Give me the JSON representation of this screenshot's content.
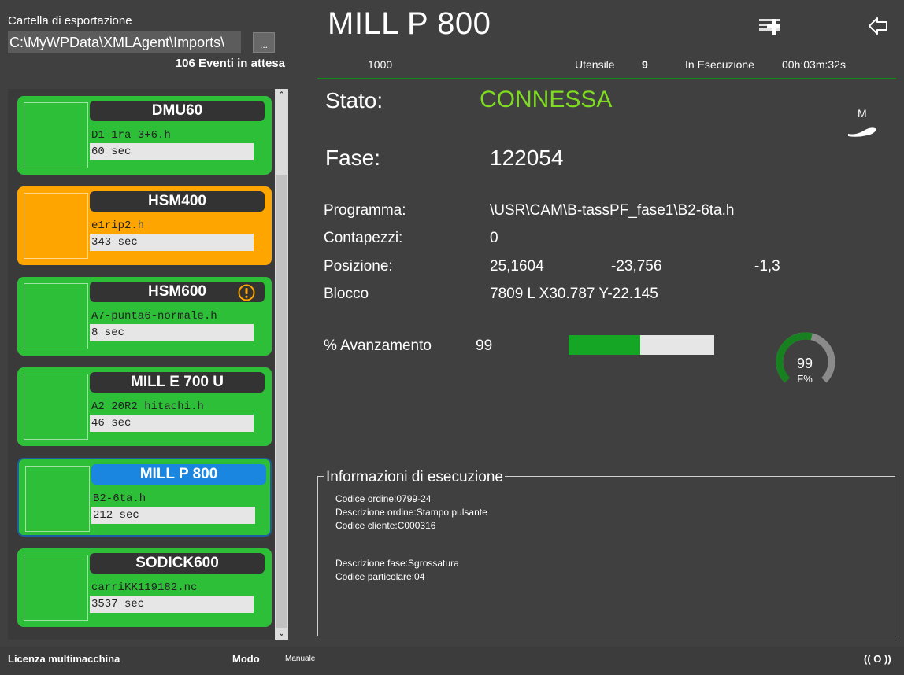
{
  "export": {
    "label": "Cartella di esportazione",
    "path": "C:\\MyWPData\\XMLAgent\\Imports\\",
    "browse_label": "...",
    "pending_events": "106 Eventi in attesa"
  },
  "machines": [
    {
      "name": "DMU60",
      "program": "D1 1ra 3+6.h",
      "time": "60 sec",
      "status_color": "#2ebf39"
    },
    {
      "name": "HSM400",
      "program": "e1rip2.h",
      "time": "343 sec",
      "status_color": "#ffa500"
    },
    {
      "name": "HSM600",
      "program": "A7-punta6-normale.h",
      "time": "8 sec",
      "status_color": "#2ebf39",
      "alert_icon": "exclamation-circle-icon"
    },
    {
      "name": "MILL E 700 U",
      "program": "A2 20R2 hitachi.h",
      "time": "46 sec",
      "status_color": "#2ebf39"
    },
    {
      "name": "MILL P 800",
      "program": "B2-6ta.h",
      "time": "212 sec",
      "status_color": "#2ebf39",
      "selected": true
    },
    {
      "name": "SODICK600",
      "program": "carriKK119182.nc",
      "time": "3537 sec",
      "status_color": "#2ebf39"
    }
  ],
  "detail": {
    "title": "MILL P 800",
    "infobar": {
      "code": "1000",
      "tool_label": "Utensile",
      "tool_value": "9",
      "state": "In Esecuzione",
      "elapsed": "00h:03m:32s"
    },
    "stato_label": "Stato:",
    "stato_value": "CONNESSA",
    "mode_letter": "M",
    "fase_label": "Fase:",
    "fase_value": "122054",
    "programma_label": "Programma:",
    "programma_value": "\\USR\\CAM\\B-tassPF_fase1\\B2-6ta.h",
    "contapezzi_label": "Contapezzi:",
    "contapezzi_value": "0",
    "posizione_label": "Posizione:",
    "pos_x": "25,1604",
    "pos_y": "-23,756",
    "pos_z": "-1,3",
    "blocco_label": "Blocco",
    "blocco_value": "7809 L X30.787 Y-22.145",
    "avanzamento_label": "% Avanzamento",
    "avanzamento_value": "99",
    "progress_bar_fraction": 0.49,
    "feed_value": "99",
    "feed_unit": "F%",
    "feed_gauge_fraction": 0.55,
    "accent_color": "#7ddc1f"
  },
  "execution_info": {
    "title": "Informazioni di esecuzione",
    "lines": [
      "Codice ordine:0799-24",
      "Descrizione ordine:Stampo pulsante",
      "Codice cliente:C000316",
      "Descrizione fase:Sgrossatura",
      "Codice particolare:04"
    ]
  },
  "footer": {
    "license": "Licenza multimacchina",
    "mode_label": "Modo",
    "mode_value": "Manuale",
    "signal_icon_text": "(( O ))"
  }
}
